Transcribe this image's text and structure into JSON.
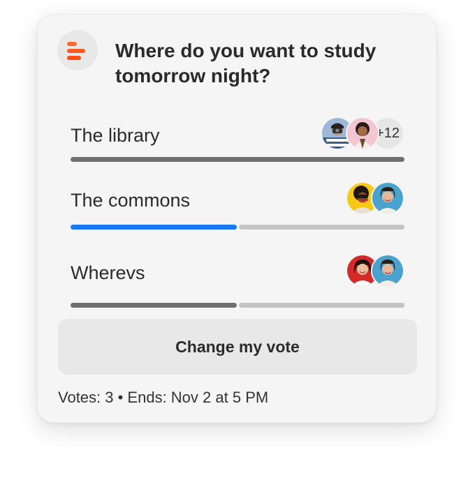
{
  "poll": {
    "question": "Where do you want to study tomorrow night?",
    "app_icon": "poll-bars-icon",
    "accent_color": "#ff5a1f",
    "selected_color": "#1877f2",
    "options": [
      {
        "label": "The library",
        "share": 1.0,
        "selected": false,
        "avatars": [
          "avatar-person-camera",
          "avatar-person-pink"
        ],
        "more_count": "+12"
      },
      {
        "label": "The commons",
        "share": 0.5,
        "selected": true,
        "avatars": [
          "avatar-person-yellow",
          "avatar-person-blue"
        ]
      },
      {
        "label": "Wherevs",
        "share": 0.5,
        "selected": false,
        "avatars": [
          "avatar-person-red",
          "avatar-person-blue"
        ]
      }
    ],
    "change_vote_label": "Change my vote",
    "footer": "Votes: 3 • Ends: Nov 2 at 5 PM"
  }
}
